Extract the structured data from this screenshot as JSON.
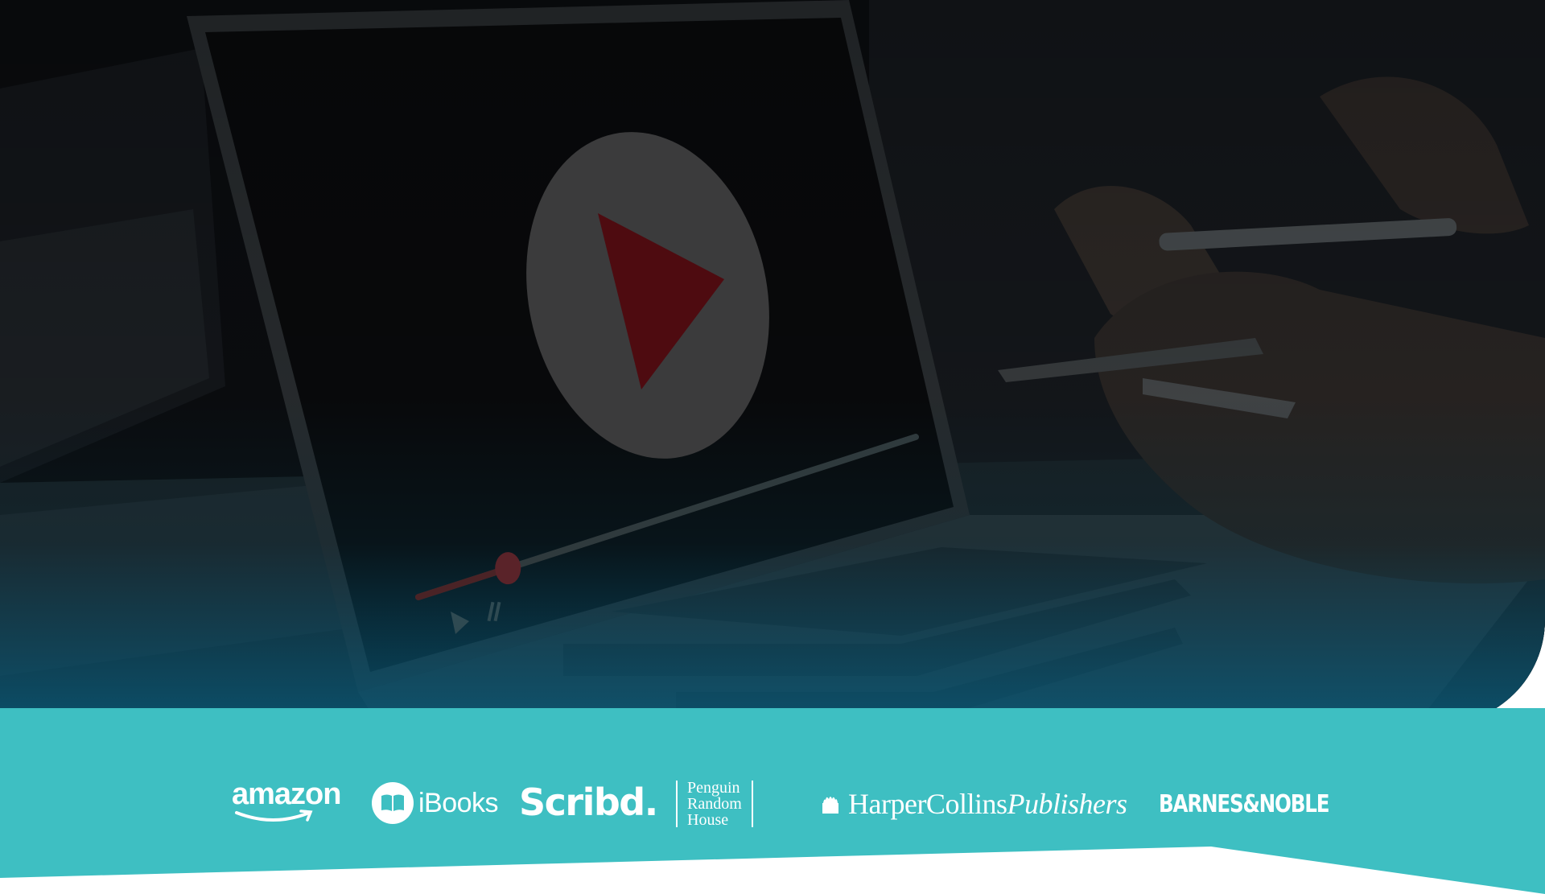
{
  "hero": {
    "scene": "laptop-video-player",
    "play_icon": "play-icon",
    "pause_icon": "pause-icon",
    "playback_progress": 0.18,
    "colors": {
      "accent": "#b3121a",
      "overlay_bottom": "#095876"
    }
  },
  "partners": {
    "band_color": "#3ebfc2",
    "logos": [
      {
        "name": "amazon",
        "text": "amazon"
      },
      {
        "name": "ibooks",
        "text": "iBooks",
        "icon": "open-book-icon"
      },
      {
        "name": "scribd",
        "text": "Scribd."
      },
      {
        "name": "penguin-random-house",
        "lines": [
          "Penguin",
          "Random",
          "House"
        ]
      },
      {
        "name": "harpercollins",
        "text_regular": "HarperCollins",
        "text_italic": "Publishers",
        "icon": "flame-fire-icon"
      },
      {
        "name": "barnes-noble",
        "text": "BARNES&NOBLE"
      }
    ]
  }
}
